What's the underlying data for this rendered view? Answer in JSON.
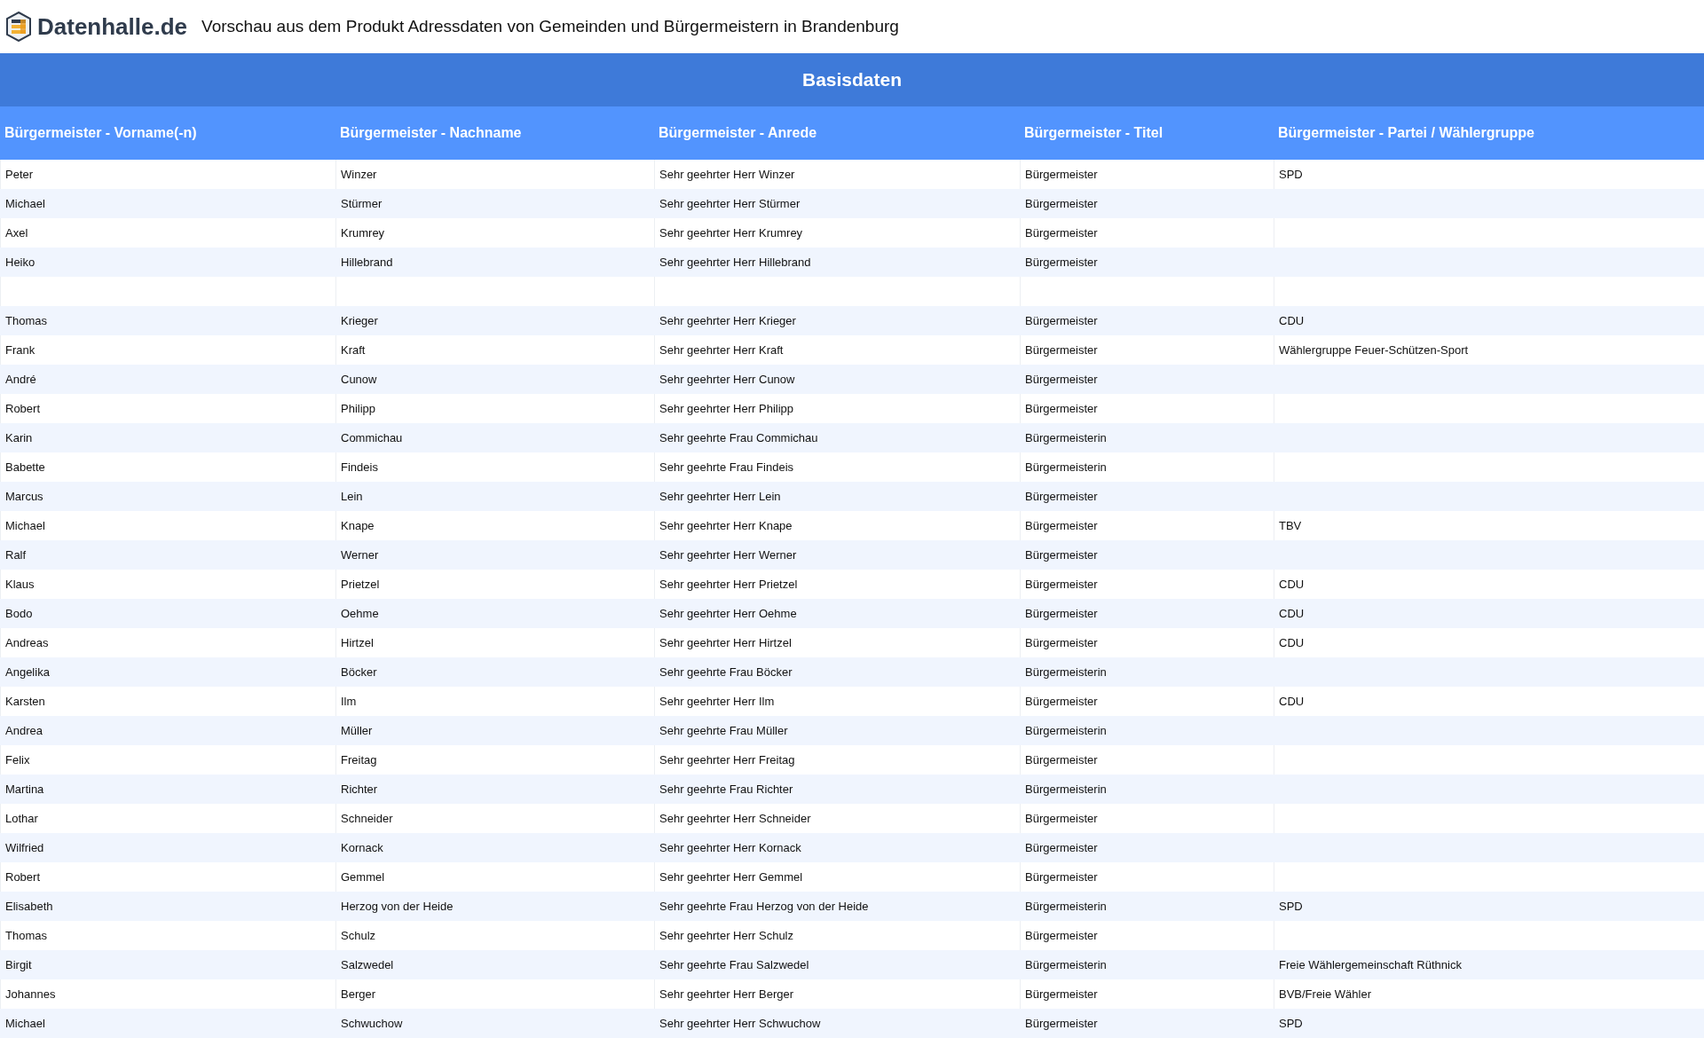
{
  "header": {
    "logo_text": "Datenhalle.de",
    "title": "Vorschau aus dem Produkt Adressdaten von Gemeinden und Bürgermeistern in Brandenburg"
  },
  "section": {
    "title": "Basisdaten"
  },
  "table": {
    "columns": [
      "Bürgermeister - Vorname(-n)",
      "Bürgermeister - Nachname",
      "Bürgermeister - Anrede",
      "Bürgermeister - Titel",
      "Bürgermeister - Partei / Wählergruppe"
    ],
    "rows": [
      {
        "first_name": "Peter",
        "last_name": "Winzer",
        "salutation": "Sehr geehrter Herr Winzer",
        "title": "Bürgermeister",
        "party": "SPD"
      },
      {
        "first_name": "Michael",
        "last_name": "Stürmer",
        "salutation": "Sehr geehrter Herr Stürmer",
        "title": "Bürgermeister"
      },
      {
        "first_name": "Axel",
        "last_name": "Krumrey",
        "salutation": "Sehr geehrter Herr Krumrey",
        "title": "Bürgermeister"
      },
      {
        "first_name": "Heiko",
        "last_name": "Hillebrand",
        "salutation": "Sehr geehrter Herr Hillebrand",
        "title": "Bürgermeister"
      },
      {},
      {
        "first_name": "Thomas",
        "last_name": "Krieger",
        "salutation": "Sehr geehrter Herr Krieger",
        "title": "Bürgermeister",
        "party": "CDU"
      },
      {
        "first_name": "Frank",
        "last_name": "Kraft",
        "salutation": "Sehr geehrter Herr Kraft",
        "title": "Bürgermeister",
        "party": "Wählergruppe Feuer-Schützen-Sport"
      },
      {
        "first_name": "André",
        "last_name": "Cunow",
        "salutation": "Sehr geehrter Herr Cunow",
        "title": "Bürgermeister"
      },
      {
        "first_name": "Robert",
        "last_name": "Philipp",
        "salutation": "Sehr geehrter Herr Philipp",
        "title": "Bürgermeister"
      },
      {
        "first_name": "Karin",
        "last_name": "Commichau",
        "salutation": "Sehr geehrte Frau Commichau",
        "title": "Bürgermeisterin"
      },
      {
        "first_name": "Babette",
        "last_name": "Findeis",
        "salutation": "Sehr geehrte Frau Findeis",
        "title": "Bürgermeisterin"
      },
      {
        "first_name": "Marcus",
        "last_name": "Lein",
        "salutation": "Sehr geehrter Herr Lein",
        "title": "Bürgermeister"
      },
      {
        "first_name": "Michael",
        "last_name": "Knape",
        "salutation": "Sehr geehrter Herr Knape",
        "title": "Bürgermeister",
        "party": "TBV"
      },
      {
        "first_name": "Ralf",
        "last_name": "Werner",
        "salutation": "Sehr geehrter Herr Werner",
        "title": "Bürgermeister"
      },
      {
        "first_name": "Klaus",
        "last_name": "Prietzel",
        "salutation": "Sehr geehrter Herr Prietzel",
        "title": "Bürgermeister",
        "party": "CDU"
      },
      {
        "first_name": "Bodo",
        "last_name": "Oehme",
        "salutation": "Sehr geehrter Herr Oehme",
        "title": "Bürgermeister",
        "party": "CDU"
      },
      {
        "first_name": "Andreas",
        "last_name": "Hirtzel",
        "salutation": "Sehr geehrter Herr Hirtzel",
        "title": "Bürgermeister",
        "party": "CDU"
      },
      {
        "first_name": "Angelika",
        "last_name": "Böcker",
        "salutation": "Sehr geehrte Frau Böcker",
        "title": "Bürgermeisterin"
      },
      {
        "first_name": "Karsten",
        "last_name": "Ilm",
        "salutation": "Sehr geehrter Herr Ilm",
        "title": "Bürgermeister",
        "party": "CDU"
      },
      {
        "first_name": "Andrea",
        "last_name": "Müller",
        "salutation": "Sehr geehrte Frau Müller",
        "title": "Bürgermeisterin"
      },
      {
        "first_name": "Felix",
        "last_name": "Freitag",
        "salutation": "Sehr geehrter Herr Freitag",
        "title": "Bürgermeister"
      },
      {
        "first_name": "Martina",
        "last_name": "Richter",
        "salutation": "Sehr geehrte Frau Richter",
        "title": "Bürgermeisterin"
      },
      {
        "first_name": "Lothar",
        "last_name": "Schneider",
        "salutation": "Sehr geehrter Herr Schneider",
        "title": "Bürgermeister"
      },
      {
        "first_name": "Wilfried",
        "last_name": "Kornack",
        "salutation": "Sehr geehrter Herr Kornack",
        "title": "Bürgermeister"
      },
      {
        "first_name": "Robert",
        "last_name": "Gemmel",
        "salutation": "Sehr geehrter Herr Gemmel",
        "title": "Bürgermeister"
      },
      {
        "first_name": "Elisabeth",
        "last_name": "Herzog von der Heide",
        "salutation": "Sehr geehrte Frau Herzog von der Heide",
        "title": "Bürgermeisterin",
        "party": "SPD"
      },
      {
        "first_name": "Thomas",
        "last_name": "Schulz",
        "salutation": "Sehr geehrter Herr Schulz",
        "title": "Bürgermeister"
      },
      {
        "first_name": "Birgit",
        "last_name": "Salzwedel",
        "salutation": "Sehr geehrte Frau Salzwedel",
        "title": "Bürgermeisterin",
        "party": "Freie Wählergemeinschaft Rüthnick"
      },
      {
        "first_name": "Johannes",
        "last_name": "Berger",
        "salutation": "Sehr geehrter Herr Berger",
        "title": "Bürgermeister",
        "party": "BVB/Freie Wähler"
      },
      {
        "first_name": "Michael",
        "last_name": "Schwuchow",
        "salutation": "Sehr geehrter Herr Schwuchow",
        "title": "Bürgermeister",
        "party": "SPD"
      }
    ]
  }
}
